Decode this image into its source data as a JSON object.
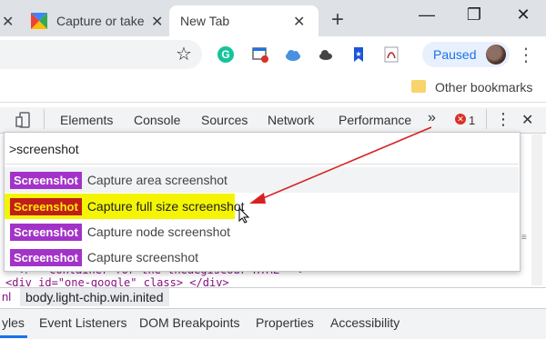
{
  "tabs": [
    {
      "title": "Capture or take",
      "close": "✕"
    },
    {
      "title": "New Tab",
      "close": "✕"
    }
  ],
  "tabstrip": {
    "new_tab": "+",
    "minimize": "—",
    "maximize": "❐",
    "close": "✕"
  },
  "toolbar": {
    "star": "☆",
    "paused_label": "Paused",
    "menu": "⋮"
  },
  "bookmarks": {
    "other": "Other bookmarks"
  },
  "devtools": {
    "tabs": [
      "Elements",
      "Console",
      "Sources",
      "Network",
      "Performance"
    ],
    "more": "»",
    "error_count": "1",
    "menu": "⋮",
    "close": "✕",
    "code_line1": "<!-- container for the theaegiscour HTML -->",
    "code_line2": "<div id=\"one-google\" class> </div>",
    "breadcrumb_left": "nl",
    "breadcrumb": "body.light-chip.win.inited",
    "subtabs": [
      "yles",
      "Event Listeners",
      "DOM Breakpoints",
      "Properties",
      "Accessibility"
    ]
  },
  "command_menu": {
    "query": ">screenshot",
    "items": [
      {
        "badge": "Screenshot",
        "label": "Capture area screenshot"
      },
      {
        "badge": "Screenshot",
        "label": "Capture full size screenshot"
      },
      {
        "badge": "Screenshot",
        "label": "Capture node screenshot"
      },
      {
        "badge": "Screenshot",
        "label": "Capture screenshot"
      }
    ],
    "highlighted_index": 1
  },
  "colors": {
    "badge": "#a333c8",
    "highlight": "#f5f503",
    "highlight_badge": "#c21d1d",
    "arrow": "#d92020",
    "accent": "#1a73e8"
  }
}
